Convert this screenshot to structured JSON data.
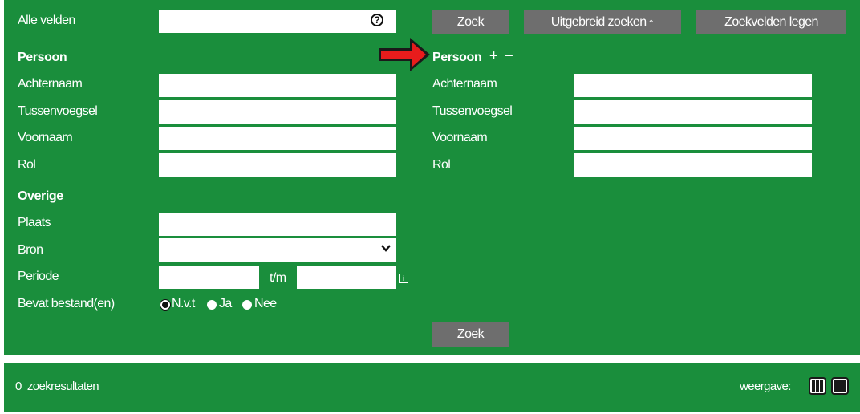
{
  "search": {
    "all_fields_label": "Alle velden",
    "all_fields_value": "",
    "search_button": "Zoek",
    "advanced_button": "Uitgebreid zoeken",
    "advanced_chevron": "⌃",
    "clear_button": "Zoekvelden legen",
    "help_icon": "?"
  },
  "person_left": {
    "heading": "Persoon",
    "fields": [
      {
        "label": "Achternaam",
        "value": ""
      },
      {
        "label": "Tussenvoegsel",
        "value": ""
      },
      {
        "label": "Voornaam",
        "value": ""
      },
      {
        "label": "Rol",
        "value": ""
      }
    ]
  },
  "person_right": {
    "heading": "Persoon",
    "add_symbol": "+",
    "remove_symbol": "−",
    "fields": [
      {
        "label": "Achternaam",
        "value": ""
      },
      {
        "label": "Tussenvoegsel",
        "value": ""
      },
      {
        "label": "Voornaam",
        "value": ""
      },
      {
        "label": "Rol",
        "value": ""
      }
    ]
  },
  "other": {
    "heading": "Overige",
    "place_label": "Plaats",
    "source_label": "Bron",
    "source_selected": "",
    "period_label": "Periode",
    "period_separator": "t/m",
    "period_info_icon": "i",
    "files_label": "Bevat bestand(en)",
    "files_options": [
      "N.v.t",
      "Ja",
      "Nee"
    ],
    "files_selected": "N.v.t"
  },
  "bottom_search_button": "Zoek",
  "results": {
    "count": "0",
    "count_label": "zoekresultaten",
    "view_label": "weergave:"
  },
  "colors": {
    "panel_green": "#1a8e3c",
    "button_gray": "#6e6e6e",
    "arrow_red": "#e81c1c"
  }
}
